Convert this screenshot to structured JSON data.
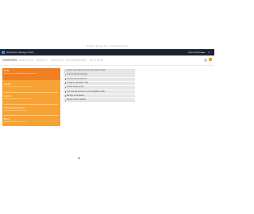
{
  "desktop": {
    "title": "Workplace Manager App — Configuration Wizard"
  },
  "window": {
    "app_name": "Workplace Manager 2019",
    "user_label": "Administrator",
    "minimize_icon": "minimize-icon",
    "close_icon": "close-icon",
    "close_glyph": "×"
  },
  "nav": {
    "tabs": [
      {
        "label": "OVERVIEW",
        "active": true
      },
      {
        "label": "ANALYTICS",
        "active": false
      },
      {
        "label": "PEOPLE",
        "active": false
      },
      {
        "label": "POLICIES",
        "active": false
      },
      {
        "label": "INTEGRATIONS",
        "active": false
      },
      {
        "label": "SETTINGS",
        "active": false
      }
    ],
    "icons": [
      "bell-icon",
      "notification-badge"
    ]
  },
  "left_panel": {
    "items": [
      {
        "title": "Profile",
        "subtitle": "Manage your personal details and preferences",
        "active": true
      },
      {
        "title": "Security",
        "subtitle": "Passwords, sign-in and recovery options",
        "active": false
      },
      {
        "title": "Devices",
        "subtitle": "Manage registered devices and access",
        "active": false
      },
      {
        "title": "Privacy and permissions",
        "subtitle": "Control how your data is shared",
        "active": false
      },
      {
        "title": "Billing",
        "subtitle": "Payment methods and invoices",
        "active": false
      }
    ]
  },
  "list": {
    "items": [
      "Update personal information and contact details",
      "Change display language",
      "Set time zone preference",
      "Configure notification rules",
      "Upload profile picture",
      "Link external accounts to your workplace profile",
      "Manage email aliases",
      "Review account activity"
    ]
  },
  "colors": {
    "accent": "#f07f22",
    "panel": "#f7a234",
    "titlebar": "#1b2330",
    "tab_inactive": "#d8a3a3"
  }
}
